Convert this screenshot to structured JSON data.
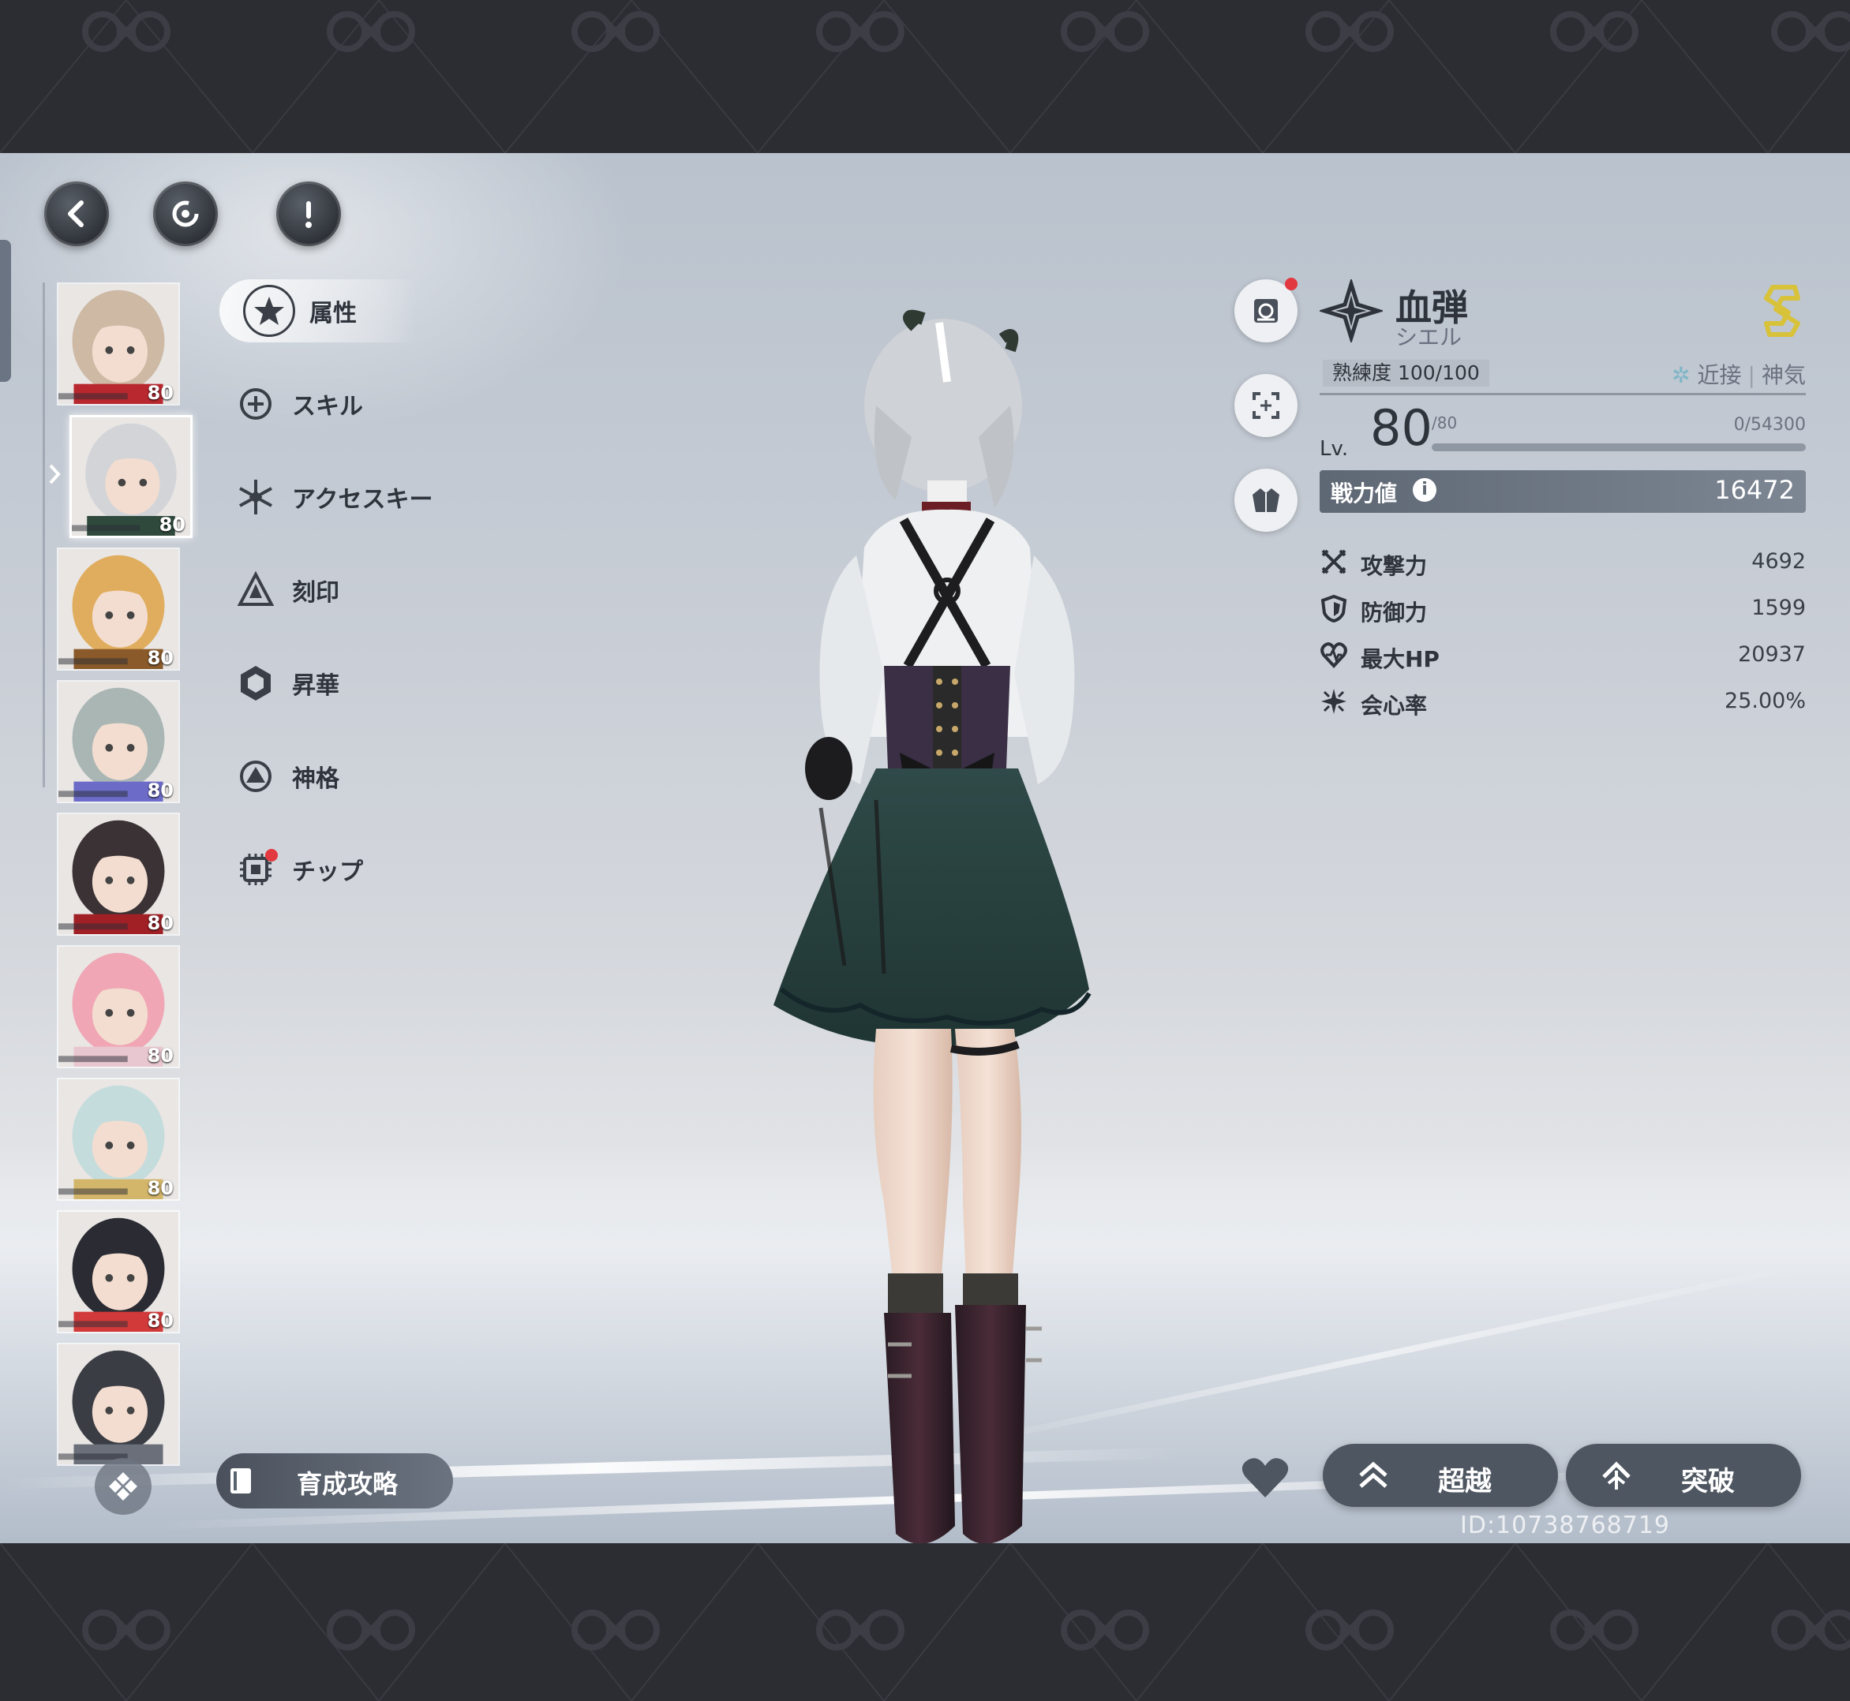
{
  "topbar": {
    "back_icon": "chevron-left-icon",
    "refresh_icon": "refresh-icon",
    "info_icon": "exclamation-icon"
  },
  "roster": [
    {
      "level": "80",
      "hair": "#cdb9a4",
      "accent": "#b8282e"
    },
    {
      "level": "80",
      "hair": "#d2d4d8",
      "accent": "#2f4a3c",
      "selected": true
    },
    {
      "level": "80",
      "hair": "#e0ad5e",
      "accent": "#8a5a2a"
    },
    {
      "level": "80",
      "hair": "#a9b6b4",
      "accent": "#6c6cc8"
    },
    {
      "level": "80",
      "hair": "#3a3234",
      "accent": "#a02026"
    },
    {
      "level": "80",
      "hair": "#f0a6b4",
      "accent": "#e9c7d0"
    },
    {
      "level": "80",
      "hair": "#c5dcdc",
      "accent": "#d4b66a"
    },
    {
      "level": "80",
      "hair": "#2a2b33",
      "accent": "#d23a3a"
    },
    {
      "level": "",
      "hair": "#3b3d45",
      "accent": "#6a6f7a"
    }
  ],
  "menu": [
    {
      "label": "属性",
      "icon": "star-circle-icon",
      "active": true
    },
    {
      "label": "スキル",
      "icon": "plus-circle-icon"
    },
    {
      "label": "アクセスキー",
      "icon": "snowflake-icon"
    },
    {
      "label": "刻印",
      "icon": "pyramid-icon"
    },
    {
      "label": "昇華",
      "icon": "hexagon-icon"
    },
    {
      "label": "神格",
      "icon": "triangle-circle-icon"
    },
    {
      "label": "チップ",
      "icon": "chip-icon",
      "badge": true
    }
  ],
  "character": {
    "name": "血弾",
    "subname": "シエル",
    "mastery": "熟練度 100/100",
    "tags": [
      "近接",
      "神気"
    ],
    "level_label": "Lv.",
    "level": "80",
    "level_max": "/80",
    "exp": "0/54300",
    "power_label": "戦力値",
    "power_info": "i",
    "power": "16472",
    "stats": [
      {
        "name": "攻撃力",
        "value": "4692",
        "icon": "crossed-swords-icon"
      },
      {
        "name": "防御力",
        "value": "1599",
        "icon": "shield-icon"
      },
      {
        "name": "最大HP",
        "value": "20937",
        "icon": "heart-icon"
      },
      {
        "name": "会心率",
        "value": "25.00%",
        "icon": "burst-icon"
      }
    ],
    "rank_icon": "rank-s-icon"
  },
  "buttons": {
    "guide": "育成攻略",
    "transcend": "超越",
    "breakthrough": "突破"
  },
  "uid": "ID:10738768719",
  "colors": {
    "dark_button": "#4e5661",
    "badge": "#e2383f",
    "rank_gold": "#d8c23a"
  }
}
